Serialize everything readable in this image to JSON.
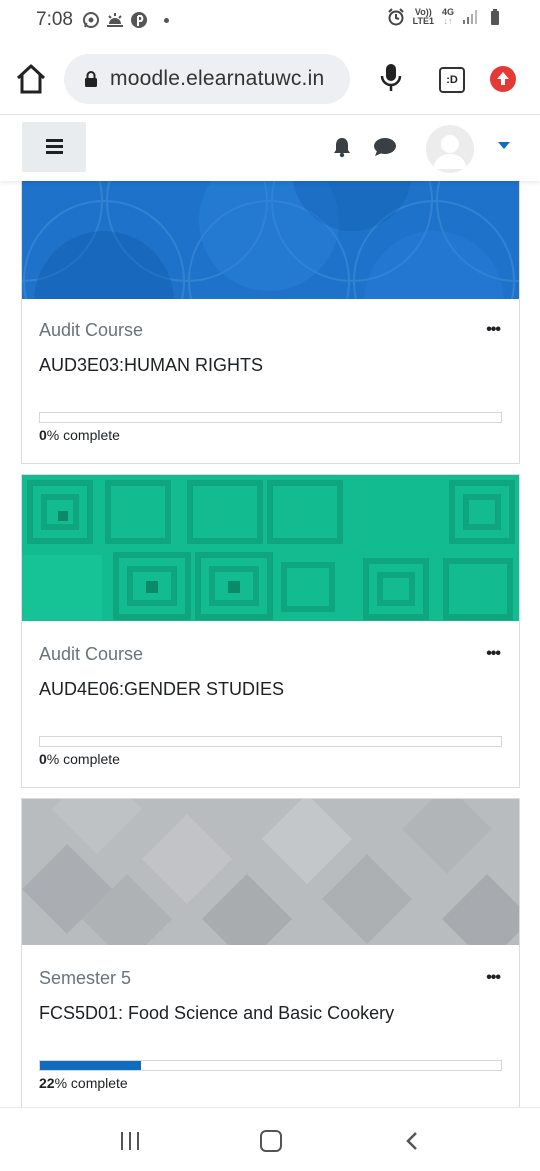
{
  "status_bar": {
    "time": "7:08",
    "volte_line1": "Vo))",
    "volte_line2": "LTE1",
    "network": "4G"
  },
  "browser": {
    "url": "moodle.elearnatuwc.in",
    "tab_switcher": ":D"
  },
  "courses": [
    {
      "category": "Audit Course",
      "name": "AUD3E03:HUMAN RIGHTS",
      "progress_value": "0",
      "progress_suffix": "% complete",
      "progress_fraction": 0,
      "menu": "•••",
      "banner": "blue-circles"
    },
    {
      "category": "Audit Course",
      "name": "AUD4E06:GENDER STUDIES",
      "progress_value": "0",
      "progress_suffix": "% complete",
      "progress_fraction": 0,
      "menu": "•••",
      "banner": "green-squares"
    },
    {
      "category": "Semester 5",
      "name": "FCS5D01: Food Science and Basic Cookery",
      "progress_value": "22",
      "progress_suffix": "% complete",
      "progress_fraction": 0.22,
      "menu": "•••",
      "banner": "grey-diamonds"
    }
  ],
  "colors": {
    "accent": "#0f6cbf",
    "blue_banner": "#1f72c9",
    "green_banner": "#13bc90",
    "grey_banner": "#b9bcbf"
  }
}
